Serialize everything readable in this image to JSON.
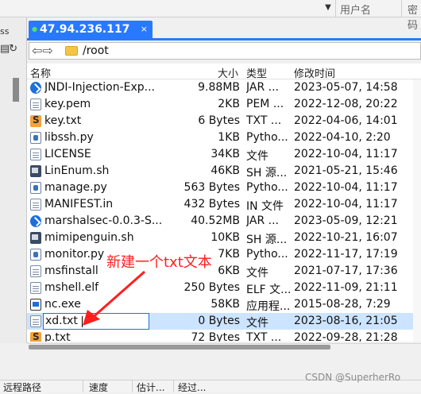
{
  "top": {
    "username_col": "用户名",
    "password_col": "密码"
  },
  "left": {
    "tab_fragment": "ss",
    "dropdown": "▼"
  },
  "tab": {
    "title": "47.94.236.117",
    "close": "×"
  },
  "path": {
    "value": "/root",
    "nav": "⇦⇨"
  },
  "columns": {
    "name": "名称",
    "size": "大小",
    "type": "类型",
    "modified": "修改时间"
  },
  "files": [
    {
      "icon": "jar",
      "name": "JNDI-Injection-Exp...",
      "size": "9.88MB",
      "type": "JAR ...",
      "modified": "2023-05-07, 14:58"
    },
    {
      "icon": "doc",
      "name": "key.pem",
      "size": "2KB",
      "type": "PEM ...",
      "modified": "2022-12-08, 20:22"
    },
    {
      "icon": "txt",
      "name": "key.txt",
      "size": "6 Bytes",
      "type": "TXT ...",
      "modified": "2022-04-06, 14:01"
    },
    {
      "icon": "py",
      "name": "libssh.py",
      "size": "1KB",
      "type": "Pytho...",
      "modified": "2022-04-10, 2:20"
    },
    {
      "icon": "doc",
      "name": "LICENSE",
      "size": "34KB",
      "type": "文件",
      "modified": "2022-10-04, 11:17"
    },
    {
      "icon": "sh",
      "name": "LinEnum.sh",
      "size": "46KB",
      "type": "SH 源...",
      "modified": "2021-05-21, 15:46"
    },
    {
      "icon": "py",
      "name": "manage.py",
      "size": "563 Bytes",
      "type": "Pytho...",
      "modified": "2022-10-04, 11:17"
    },
    {
      "icon": "doc",
      "name": "MANIFEST.in",
      "size": "432 Bytes",
      "type": "IN 文件",
      "modified": "2022-10-04, 11:17"
    },
    {
      "icon": "jar",
      "name": "marshalsec-0.0.3-S...",
      "size": "40.52MB",
      "type": "JAR ...",
      "modified": "2023-05-09, 12:21"
    },
    {
      "icon": "sh",
      "name": "mimipenguin.sh",
      "size": "10KB",
      "type": "SH 源...",
      "modified": "2022-10-21, 16:07"
    },
    {
      "icon": "py",
      "name": "monitor.py",
      "size": "7KB",
      "type": "Pytho...",
      "modified": "2022-11-17, 17:19"
    },
    {
      "icon": "doc",
      "name": "msfinstall",
      "size": "6KB",
      "type": "文件",
      "modified": "2021-07-17, 17:36"
    },
    {
      "icon": "doc",
      "name": "mshell.elf",
      "size": "250 Bytes",
      "type": "ELF 文...",
      "modified": "2022-11-09, 21:11"
    },
    {
      "icon": "exe",
      "name": "nc.exe",
      "size": "58KB",
      "type": "应用程...",
      "modified": "2015-08-28, 7:29"
    },
    {
      "icon": "doc",
      "name": "xd.txt",
      "size": "0 Bytes",
      "type": "文件",
      "modified": "2023-08-16, 21:05",
      "renaming": true
    },
    {
      "icon": "txt",
      "name": "p.txt",
      "size": "72 Bytes",
      "type": "TXT ...",
      "modified": "2022-09-28, 21:28"
    }
  ],
  "annotation": {
    "text": "新建一个txt文本",
    "color": "#ff1f1f"
  },
  "transfer": {
    "remote_path": "远程路径",
    "speed": "速度",
    "estimate": "估计...",
    "elapsed": "经过..."
  },
  "watermark": "CSDN @SuperherRo",
  "colors": {
    "tab_blue": "#2979ff",
    "selection": "#cce4ff"
  }
}
